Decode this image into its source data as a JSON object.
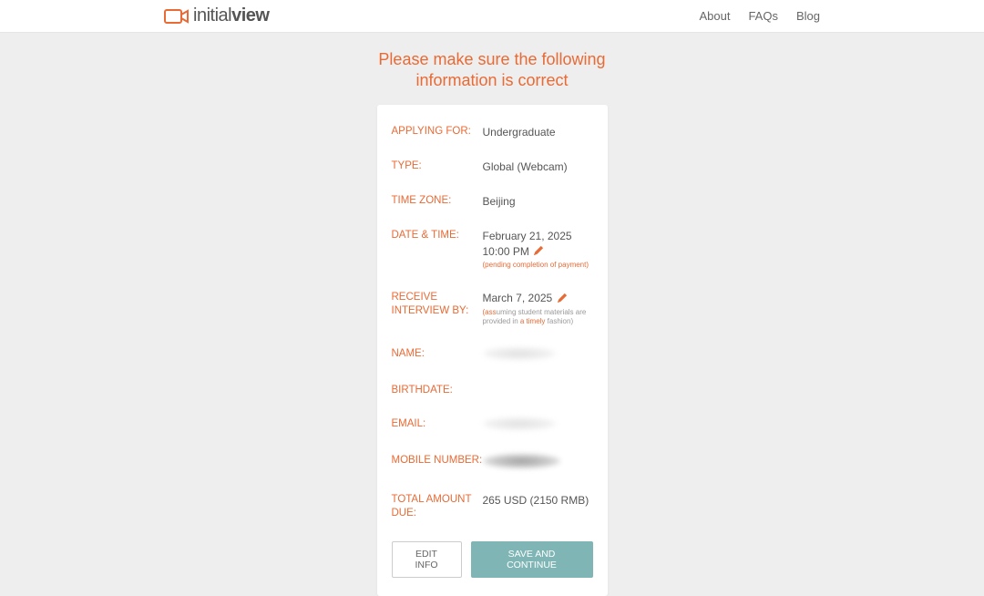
{
  "header": {
    "logo_text_1": "initial",
    "logo_text_2": "view",
    "nav": {
      "about": "About",
      "faqs": "FAQs",
      "blog": "Blog"
    }
  },
  "title_line1": "Please make sure the following",
  "title_line2": "information is correct",
  "fields": {
    "applying_for": {
      "label": "APPLYING FOR:",
      "value": "Undergraduate"
    },
    "type": {
      "label": "TYPE:",
      "value": "Global (Webcam)"
    },
    "timezone": {
      "label": "TIME ZONE:",
      "value": "Beijing"
    },
    "datetime": {
      "label": "DATE & TIME:",
      "value_line1": "February 21, 2025",
      "value_line2": "10:00 PM",
      "note": "(pending completion of payment)"
    },
    "receive_by": {
      "label": "RECEIVE INTERVIEW BY:",
      "value": "March 7, 2025",
      "note_prefix": "(ass",
      "note_rest": "uming student materials are provided in ",
      "note_prefix2": "a timely ",
      "note_rest2": "fashion)"
    },
    "name": {
      "label": "NAME:"
    },
    "birthdate": {
      "label": "BIRTHDATE:"
    },
    "email": {
      "label": "EMAIL:"
    },
    "mobile": {
      "label": "MOBILE NUMBER:"
    },
    "total": {
      "label": "TOTAL AMOUNT DUE:",
      "value": "265 USD (2150 RMB)"
    }
  },
  "buttons": {
    "edit": "EDIT INFO",
    "save": "SAVE AND CONTINUE"
  }
}
